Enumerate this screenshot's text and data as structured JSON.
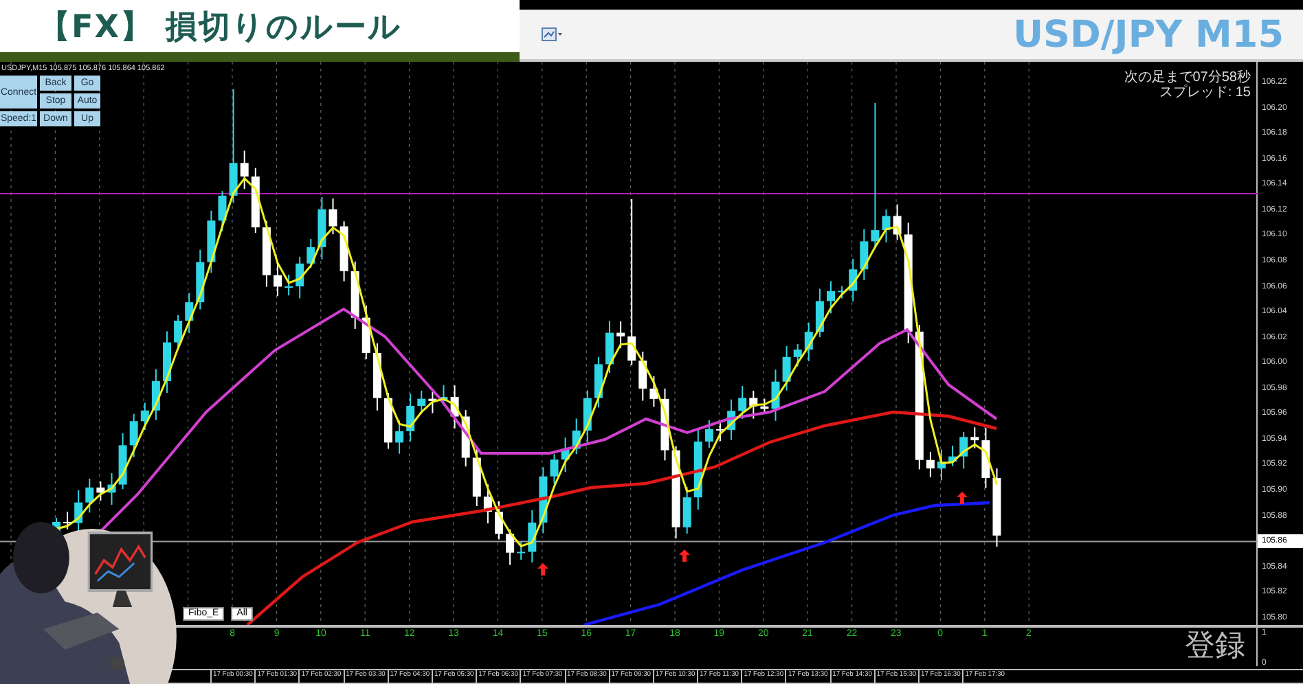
{
  "banner": {
    "title": "【FX】 損切りのルール"
  },
  "toolbar": {
    "symbol": "USD/JPY M15"
  },
  "chart": {
    "header": "USDJPY,M15  105.875 105.876 105.864 105.862",
    "controls": [
      "Connect",
      "Back",
      "Go",
      "Stop",
      "Auto",
      "Speed:1",
      "Down",
      "Up"
    ],
    "countdown": "次の足まで07分58秒",
    "spread": "スプレッド: 15",
    "price_ticks": [
      {
        "label": "106.22",
        "highlighted": false
      },
      {
        "label": "106.20",
        "highlighted": false
      },
      {
        "label": "106.18",
        "highlighted": false
      },
      {
        "label": "106.16",
        "highlighted": false
      },
      {
        "label": "106.14",
        "highlighted": false
      },
      {
        "label": "106.12",
        "highlighted": false
      },
      {
        "label": "106.10",
        "highlighted": false
      },
      {
        "label": "106.08",
        "highlighted": false
      },
      {
        "label": "106.06",
        "highlighted": false
      },
      {
        "label": "106.04",
        "highlighted": false
      },
      {
        "label": "106.02",
        "highlighted": false
      },
      {
        "label": "106.00",
        "highlighted": false
      },
      {
        "label": "105.98",
        "highlighted": false
      },
      {
        "label": "105.96",
        "highlighted": false
      },
      {
        "label": "105.94",
        "highlighted": false
      },
      {
        "label": "105.92",
        "highlighted": false
      },
      {
        "label": "105.90",
        "highlighted": false
      },
      {
        "label": "105.88",
        "highlighted": false
      },
      {
        "label": "105.86",
        "highlighted": true
      },
      {
        "label": "105.84",
        "highlighted": false
      },
      {
        "label": "105.82",
        "highlighted": false
      },
      {
        "label": "105.80",
        "highlighted": false
      }
    ],
    "buttons": [
      "Fibo_E",
      "All"
    ],
    "hour_labels": [
      "8",
      "9",
      "10",
      "11",
      "12",
      "13",
      "14",
      "15",
      "16",
      "17",
      "18",
      "19",
      "20",
      "21",
      "22",
      "23",
      "0",
      "1",
      "2"
    ],
    "indicator_ticks": [
      "1",
      "0"
    ],
    "date_labels": [
      "17 Feb 00:30",
      "17 Feb 01:30",
      "17 Feb 02:30",
      "17 Feb 03:30",
      "17 Feb 04:30",
      "17 Feb 05:30",
      "17 Feb 06:30",
      "17 Feb 07:30",
      "17 Feb 08:30",
      "17 Feb 09:30",
      "17 Feb 10:30",
      "17 Feb 11:30",
      "17 Feb 12:30",
      "17 Feb 13:30",
      "17 Feb 14:30",
      "17 Feb 15:30",
      "17 Feb 16:30",
      "17 Feb 17:30"
    ]
  },
  "overlay": {
    "caption": "登録"
  }
}
